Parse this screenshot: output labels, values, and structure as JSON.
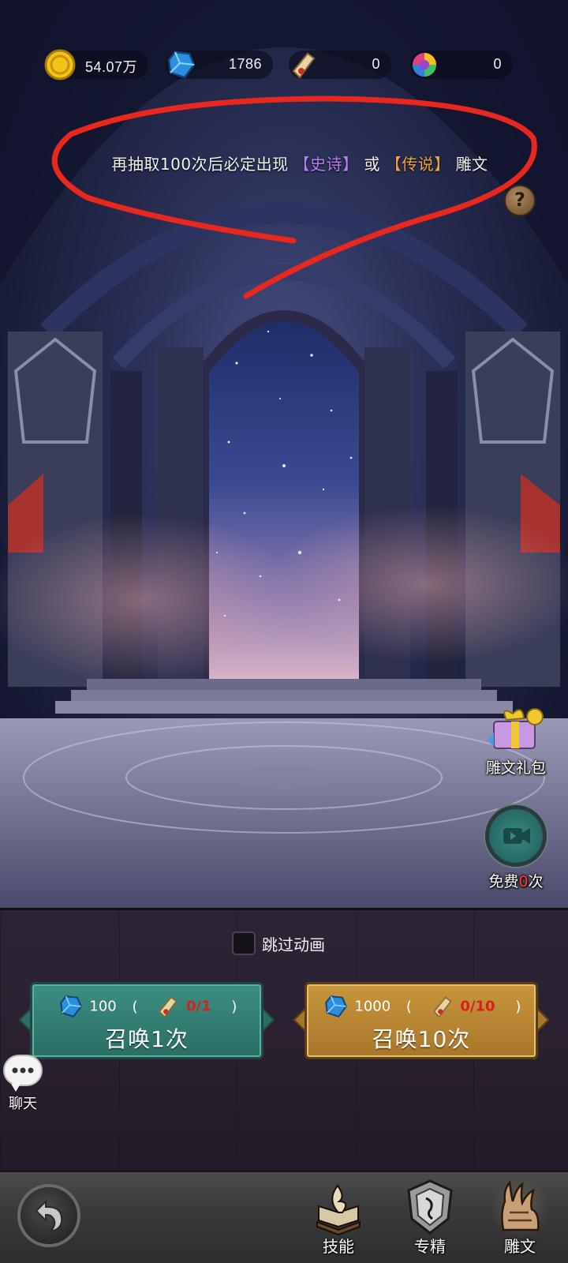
{
  "currency": {
    "gold": {
      "icon": "gold-coin-icon",
      "value": "54.07万"
    },
    "gem": {
      "icon": "blue-gem-icon",
      "value": "1786"
    },
    "scroll": {
      "icon": "summon-scroll-icon",
      "value": "0"
    },
    "rainbow": {
      "icon": "rainbow-orb-icon",
      "value": "0"
    }
  },
  "pity": {
    "lead": "再抽取100次后必定出现",
    "epic": "【史诗】",
    "or": "或",
    "legend": "【传说】",
    "tail": "雕文"
  },
  "help": {
    "label": "?"
  },
  "side": {
    "gift_pack": {
      "label": "雕文礼包"
    },
    "free_video": {
      "prefix": "免费",
      "count": "0",
      "suffix": "次"
    }
  },
  "panel": {
    "skip_label": "跳过动画",
    "summon_1": {
      "gem_cost": "100",
      "open_paren": "(",
      "scroll_cost": "0/1",
      "close_paren": ")",
      "title": "召唤1次"
    },
    "summon_10": {
      "gem_cost": "1000",
      "open_paren": "(",
      "scroll_cost": "0/10",
      "close_paren": ")",
      "title": "召唤10次"
    },
    "chat_label": "聊天"
  },
  "nav": {
    "tabs": [
      {
        "label": "技能",
        "icon": "skill-book-icon"
      },
      {
        "label": "专精",
        "icon": "specialization-shield-icon"
      },
      {
        "label": "雕文",
        "icon": "rune-claw-icon",
        "active": true
      }
    ]
  },
  "colors": {
    "epic": "#b47ff0",
    "legend": "#f0a23c",
    "summon_1": "#3d8e82",
    "summon_10": "#c8963c",
    "annotation": "#e8281e"
  }
}
